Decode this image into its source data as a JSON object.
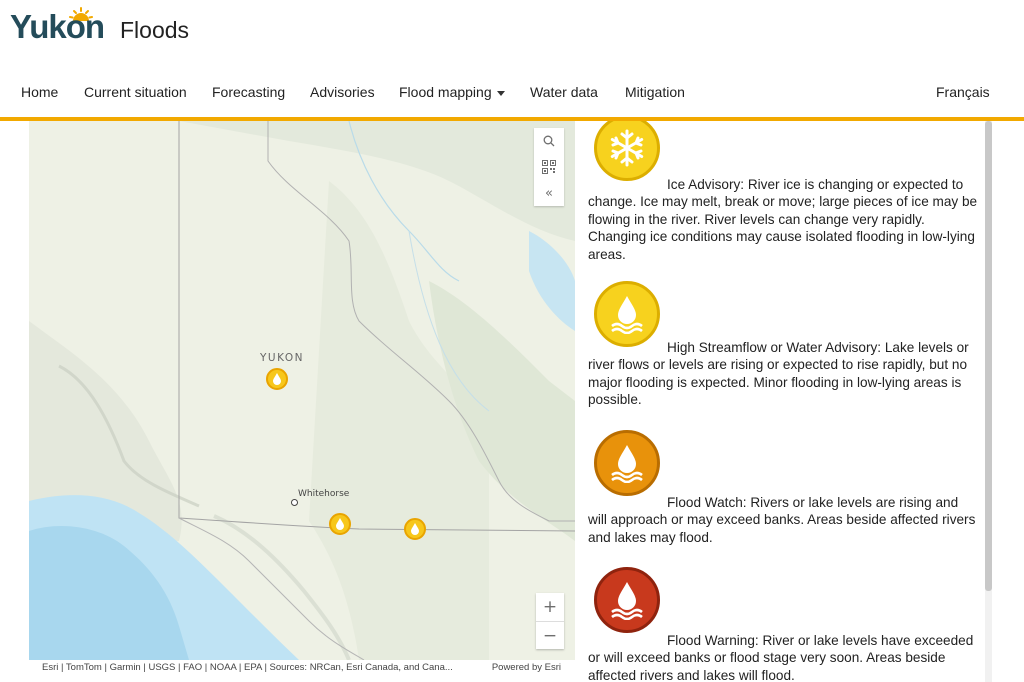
{
  "header": {
    "logo_text": "Yukon",
    "site_title": "Floods"
  },
  "nav": {
    "items": [
      {
        "label": "Home"
      },
      {
        "label": "Current situation"
      },
      {
        "label": "Forecasting"
      },
      {
        "label": "Advisories"
      },
      {
        "label": "Flood mapping",
        "has_dropdown": true
      },
      {
        "label": "Water data"
      },
      {
        "label": "Mitigation"
      }
    ],
    "language_toggle": "Français",
    "accent_color": "#f2a900"
  },
  "map": {
    "region_label": "YUKON",
    "city_label": "Whitehorse",
    "tools": [
      "search-icon",
      "qr-code-icon",
      "collapse-icon"
    ],
    "zoom_in": "+",
    "zoom_out": "−",
    "attribution": "Esri | TomTom | Garmin | USGS | FAO | NOAA | EPA | Sources: NRCan, Esri Canada, and Cana...",
    "powered_by": "Powered by Esri",
    "marker_color": "#f7c71b"
  },
  "legend": {
    "items": [
      {
        "icon": "snowflake-icon",
        "color": "#f7d21e",
        "text": "Ice Advisory: River ice is changing or expected to change. Ice may melt, break or move; large pieces of ice may be flowing in the river. River levels can change very rapidly. Changing ice conditions may cause isolated flooding in low-lying areas."
      },
      {
        "icon": "water-drop-icon",
        "color": "#f7d21e",
        "text": "High Streamflow or Water Advisory: Lake levels or river flows or levels are rising or expected to rise rapidly, but no major flooding is expected. Minor flooding in low-lying areas is possible."
      },
      {
        "icon": "water-drop-icon",
        "color": "#e8920b",
        "text": "Flood Watch: Rivers or lake levels are rising and will approach or may exceed banks. Areas beside affected rivers and lakes may flood."
      },
      {
        "icon": "water-drop-icon",
        "color": "#c8391d",
        "text": "Flood Warning: River or lake levels have exceeded or will exceed banks or flood stage very soon. Areas beside affected rivers and lakes will flood."
      }
    ]
  }
}
